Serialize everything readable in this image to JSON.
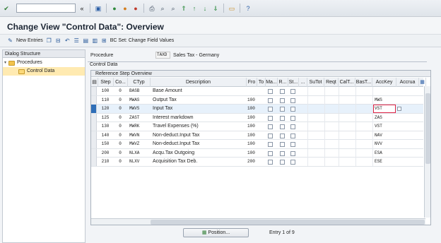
{
  "window": {
    "title": "Change View \"Control Data\": Overview"
  },
  "toolbar": {
    "command_field": "",
    "new_entries_label": "New Entries",
    "bc_set_label": "BC Set: Change Field Values"
  },
  "left_panel": {
    "header": "Dialog Structure",
    "items": [
      {
        "label": "Procedures"
      },
      {
        "label": "Control Data"
      }
    ]
  },
  "procedure": {
    "label": "Procedure",
    "value": "TAXD",
    "description": "Sales Tax - Germany"
  },
  "section_label": "Control Data",
  "table": {
    "title": "Reference Step Overview",
    "columns": [
      "Step",
      "Co...",
      "CTyp",
      "Description",
      "Fro",
      "To",
      "Ma...",
      "R...",
      "St...",
      "...",
      "SuTot",
      "Reqt",
      "CalT...",
      "BasT...",
      "AccKey",
      "Accrua"
    ],
    "rows": [
      {
        "step": "100",
        "co": "0",
        "ctyp": "BASB",
        "desc": "Base Amount",
        "fro": "",
        "acckey": ""
      },
      {
        "step": "110",
        "co": "0",
        "ctyp": "MWAS",
        "desc": "Output Tax",
        "fro": "100",
        "acckey": "MWS"
      },
      {
        "step": "120",
        "co": "0",
        "ctyp": "MWVS",
        "desc": "Input Tax",
        "fro": "100",
        "acckey": "VST"
      },
      {
        "step": "125",
        "co": "0",
        "ctyp": "ZAST",
        "desc": "Interest markdown",
        "fro": "100",
        "acckey": "ZAS"
      },
      {
        "step": "130",
        "co": "0",
        "ctyp": "MWRK",
        "desc": "Travel Expenses (%)",
        "fro": "100",
        "acckey": "VST"
      },
      {
        "step": "140",
        "co": "0",
        "ctyp": "MWVN",
        "desc": "Non-deduct.Input Tax",
        "fro": "100",
        "acckey": "NAV"
      },
      {
        "step": "150",
        "co": "0",
        "ctyp": "MWVZ",
        "desc": "Non-deduct.Input Tax",
        "fro": "100",
        "acckey": "NVV"
      },
      {
        "step": "200",
        "co": "0",
        "ctyp": "NLXA",
        "desc": "Acqu.Tax Outgoing",
        "fro": "100",
        "acckey": "ESA"
      },
      {
        "step": "210",
        "co": "0",
        "ctyp": "NLXV",
        "desc": "Acquisition Tax Deb.",
        "fro": "200",
        "acckey": "ESE"
      }
    ],
    "selected_row_index": 2
  },
  "footer": {
    "position_label": "Position...",
    "entry_text": "Entry 1 of 9"
  },
  "colors": {
    "selected_row": "#e7f1fb",
    "edit_border": "#dd2244",
    "tree_selected": "#ffeab1"
  }
}
